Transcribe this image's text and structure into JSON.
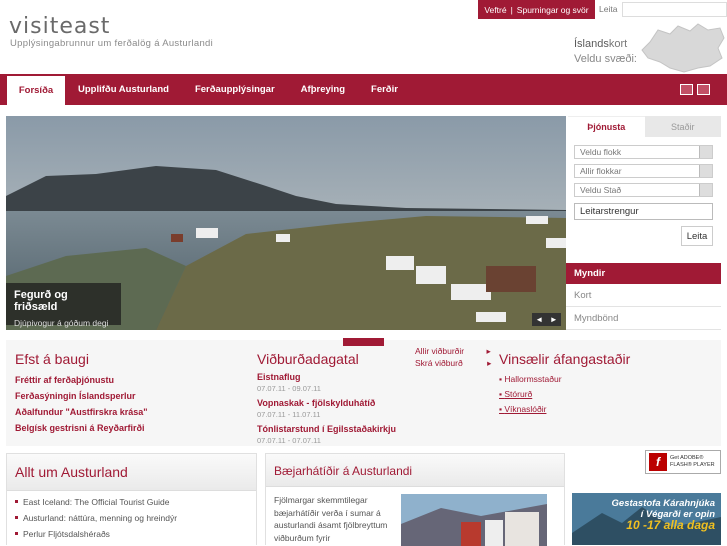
{
  "header": {
    "logo": "visiteast",
    "tagline": "Upplýsingabrunnur um ferðalög á Austurlandi",
    "top_links": [
      "Veftré",
      "|",
      "Spurningar og svör"
    ],
    "search_label": "Leita",
    "map_title_bold": "Íslands",
    "map_title_rest": "kort",
    "map_select": "Veldu svæði:"
  },
  "nav": {
    "items": [
      "Forsíða",
      "Upplifðu Austurland",
      "Ferðaupplýsingar",
      "Afþreying",
      "Ferðir"
    ],
    "icons": [
      "print-icon",
      "email-icon"
    ]
  },
  "hero": {
    "caption_title": "Fegurð og friðsæld",
    "caption_subtitle": "Djúpivogur á góðum degi",
    "prev": "◄",
    "next": "►"
  },
  "sidebar": {
    "tabs": [
      "Þjónusta",
      "Staðir"
    ],
    "select_category": "Veldu flokk",
    "select_all": "Allir flokkar",
    "select_place": "Veldu Stað",
    "search_value": "Leitarstrengur",
    "search_button": "Leita",
    "links": [
      "Myndir",
      "Kort",
      "Myndbönd"
    ]
  },
  "news": {
    "top_title": "Efst á baugi",
    "top_items": [
      "Fréttir af ferðaþjónustu",
      "Ferðasýningin Íslandsperlur",
      "Aðalfundur \"Austfirskra krása\"",
      "Belgísk gestrisni á Reyðarfirði"
    ],
    "events_title": "Viðburðadagatal",
    "events_links": [
      "Allir viðburðir",
      "Skrá viðburð"
    ],
    "events": [
      {
        "name": "Eistnaflug",
        "date": "07.07.11 - 09.07.11"
      },
      {
        "name": "Vopnaskak - fjölskylduhátíð",
        "date": "07.07.11 - 11.07.11"
      },
      {
        "name": "Tónlistarstund í Egilsstaðakirkju",
        "date": "07.07.11 - 07.07.11"
      }
    ],
    "popular_title": "Vinsælir áfangastaðir",
    "popular_items": [
      "Hallormsstaður",
      "Stórurð",
      "Víknaslóðir"
    ]
  },
  "allt": {
    "title": "Allt um Austurland",
    "items": [
      "East Iceland: The Official Tourist Guide",
      "Austurland: náttúra, menning og hreindýr",
      "Perlur Fljótsdalshéraðs"
    ]
  },
  "baejar": {
    "title": "Bæjarhátíðir á Austurlandi",
    "text": "Fjölmargar skemmtilegar bæjarhátíðir verða í sumar á austurlandi ásamt fjölbreyttum viðburðum fyrir"
  },
  "flash": {
    "line1": "Get ADOBE®",
    "line2": "FLASH® PLAYER"
  },
  "banner": {
    "line1": "Gestastofa Kárahnjúka",
    "line2": "í Végarði er opin",
    "line3": "10 -17 alla daga"
  },
  "colors": {
    "accent": "#a01a35"
  }
}
